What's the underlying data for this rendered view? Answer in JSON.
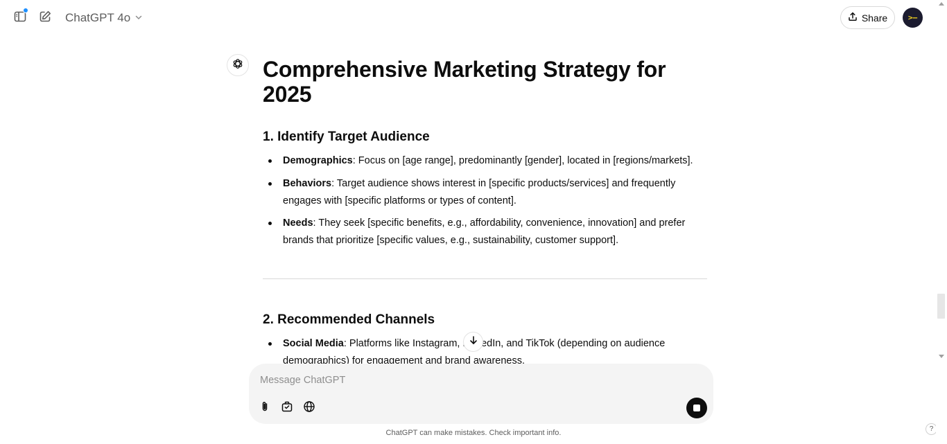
{
  "header": {
    "model_name": "ChatGPT 4o",
    "share_label": "Share",
    "avatar_text": ">—"
  },
  "icons": {
    "sidebar": "sidebar-toggle-icon",
    "new_chat": "edit-icon",
    "model_dropdown": "chevron-down-icon",
    "share": "upload-icon",
    "assistant": "openai-logo-icon",
    "scroll_down": "arrow-down-icon",
    "attach": "paperclip-icon",
    "tools": "toolbox-icon",
    "search": "globe-icon",
    "stop": "stop-icon"
  },
  "colors": {
    "notification_dot": "#1e90ff",
    "avatar_bg": "#1b1b2f",
    "composer_bg": "#f4f4f4"
  },
  "message": {
    "title": "Comprehensive Marketing Strategy for 2025",
    "sections": [
      {
        "heading": "1. Identify Target Audience",
        "items": [
          {
            "label": "Demographics",
            "text": ": Focus on [age range], predominantly [gender], located in [regions/markets]."
          },
          {
            "label": "Behaviors",
            "text": ": Target audience shows interest in [specific products/services] and frequently engages with [specific platforms or types of content]."
          },
          {
            "label": "Needs",
            "text": ": They seek [specific benefits, e.g., affordability, convenience, innovation] and prefer brands that prioritize [specific values, e.g., sustainability, customer support]."
          }
        ]
      },
      {
        "heading": "2. Recommended Channels",
        "items": [
          {
            "label": "Social Media",
            "text": ": Platforms like Instagram, LinkedIn, and TikTok (depending on audience demographics) for engagement and brand awareness."
          }
        ]
      }
    ]
  },
  "composer": {
    "placeholder": "Message ChatGPT"
  },
  "footer": {
    "disclaimer": "ChatGPT can make mistakes. Check important info.",
    "help_label": "?"
  }
}
